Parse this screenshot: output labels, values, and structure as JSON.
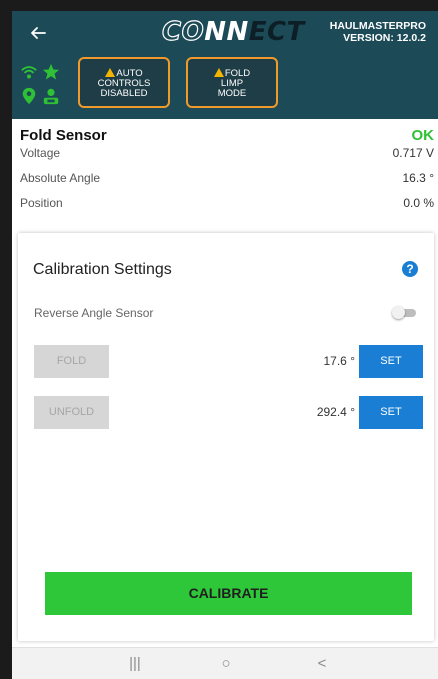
{
  "header": {
    "back_icon": "back-arrow-icon",
    "logo_co": "CO",
    "logo_nn": "NN",
    "logo_ect": "ECT",
    "brand_name": "HAULMASTERPRO",
    "version": "VERSION: 12.0.2",
    "colors": {
      "background": "#1c4a57",
      "text": "#ffffff"
    }
  },
  "status": {
    "icons": [
      "wifi-icon",
      "star-icon",
      "location-pin-icon",
      "user-icon"
    ],
    "icon_color": "#2fc135",
    "warnings": [
      {
        "icon": "warning-triangle-icon",
        "label": "AUTO",
        "label2": "CONTROLS",
        "label3": "DISABLED"
      },
      {
        "icon": "warning-triangle-icon",
        "label": "FOLD",
        "label2": "LIMP",
        "label3": "MODE"
      }
    ],
    "warning_border_color": "#f09a2b"
  },
  "sensor": {
    "title": "Fold Sensor",
    "status": "OK",
    "status_color": "#2fc135",
    "rows": [
      {
        "label": "Voltage",
        "value": "0.717 V"
      },
      {
        "label": "Absolute Angle",
        "value": "16.3 °"
      },
      {
        "label": "Position",
        "value": "0.0 %"
      }
    ]
  },
  "calibration": {
    "title": "Calibration Settings",
    "help_icon": "?",
    "reverse_label": "Reverse Angle Sensor",
    "reverse_enabled": false,
    "fold": {
      "button_label": "FOLD",
      "angle": "17.6 °",
      "set_label": "SET"
    },
    "unfold": {
      "button_label": "UNFOLD",
      "angle": "292.4 °",
      "set_label": "SET"
    },
    "calibrate_label": "CALIBRATE",
    "colors": {
      "set_button": "#1a7fd4",
      "calibrate_button": "#2fc73a",
      "disabled_button": "#d6d6d6"
    }
  },
  "navbar": {
    "recents_icon": "|||",
    "home_icon": "○",
    "back_icon": "<"
  }
}
